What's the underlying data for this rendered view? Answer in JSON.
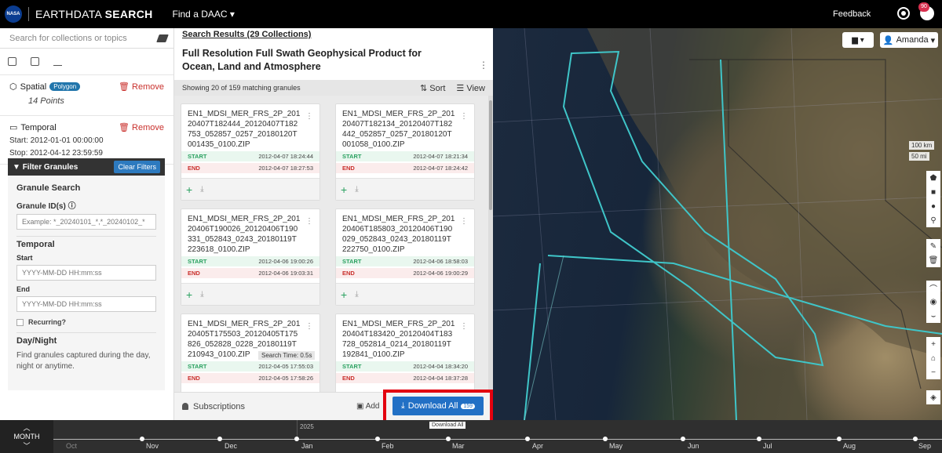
{
  "topbar": {
    "logo_text": "NASA",
    "brand_prefix": "EARTHDATA",
    "brand_suffix": "SEARCH",
    "find_daac": "Find a DAAC ▾",
    "feedback": "Feedback",
    "user_badge": "90"
  },
  "sidebar": {
    "search_placeholder": "Search for collections or topics",
    "spatial": {
      "label": "Spatial",
      "pill": "Polygon",
      "remove": "Remove",
      "detail": "14 Points"
    },
    "temporal": {
      "label": "Temporal",
      "remove": "Remove",
      "start": "Start: 2012-01-01 00:00:00",
      "stop": "Stop: 2012-04-12 23:59:59"
    },
    "filter": {
      "title": "Filter Granules",
      "clear": "Clear Filters",
      "granule_search": "Granule Search",
      "granule_ids": "Granule ID(s)",
      "granule_ids_placeholder": "Example: *_20240101_*,*_20240102_*",
      "temporal": "Temporal",
      "start": "Start",
      "start_placeholder": "YYYY-MM-DD HH:mm:ss",
      "end": "End",
      "end_placeholder": "YYYY-MM-DD HH:mm:ss",
      "recurring": "Recurring?",
      "day_night": "Day/Night",
      "day_night_desc": "Find granules captured during the day, night or anytime."
    }
  },
  "results": {
    "header": "Search Results (29 Collections)",
    "title": "Full Resolution Full Swath Geophysical Product for Ocean, Land and Atmosphere",
    "showing": "Showing 20 of 159 matching granules",
    "sort": "Sort",
    "view": "View",
    "start_label": "START",
    "end_label": "END",
    "granules": [
      {
        "name": "EN1_MDSI_MER_FRS_2P_20120407T182444_20120407T182753_052857_0257_20180120T001435_0100.ZIP",
        "start": "2012-04-07 18:24:44",
        "end": "2012-04-07 18:27:53"
      },
      {
        "name": "EN1_MDSI_MER_FRS_2P_20120407T182134_20120407T182442_052857_0257_20180120T001058_0100.ZIP",
        "start": "2012-04-07 18:21:34",
        "end": "2012-04-07 18:24:42"
      },
      {
        "name": "EN1_MDSI_MER_FRS_2P_20120406T190026_20120406T190331_052843_0243_20180119T223618_0100.ZIP",
        "start": "2012-04-06 19:00:26",
        "end": "2012-04-06 19:03:31"
      },
      {
        "name": "EN1_MDSI_MER_FRS_2P_20120406T185803_20120406T190029_052843_0243_20180119T222750_0100.ZIP",
        "start": "2012-04-06 18:58:03",
        "end": "2012-04-06 19:00:29"
      },
      {
        "name": "EN1_MDSI_MER_FRS_2P_20120405T175503_20120405T175826_052828_0228_20180119T210943_0100.ZIP",
        "start": "2012-04-05 17:55:03",
        "end": "2012-04-05 17:58:26"
      },
      {
        "name": "EN1_MDSI_MER_FRS_2P_20120404T183420_20120404T183728_052814_0214_20180119T192841_0100.ZIP",
        "start": "2012-04-04 18:34:20",
        "end": "2012-04-04 18:37:28"
      }
    ],
    "search_time": "Search Time: 0.5s",
    "subscriptions": "Subscriptions",
    "add": "Add",
    "download_all": "Download All",
    "download_count": "159",
    "download_tooltip": "Download All"
  },
  "map": {
    "save_label": "▾",
    "account": "Amanda",
    "scale_km": "100 km",
    "scale_mi": "50 mi"
  },
  "timeline": {
    "zoom": "MONTH",
    "year": "2025",
    "months": [
      "Oct",
      "Nov",
      "Dec",
      "Jan",
      "Feb",
      "Mar",
      "Apr",
      "May",
      "Jun",
      "Jul",
      "Aug",
      "Sep"
    ]
  },
  "colors": {
    "brand_blue": "#2270c5",
    "highlight_red": "#e3000f",
    "start_green": "#2aa160",
    "end_red": "#c9302c",
    "footprint_cyan": "#3fc5c8"
  }
}
